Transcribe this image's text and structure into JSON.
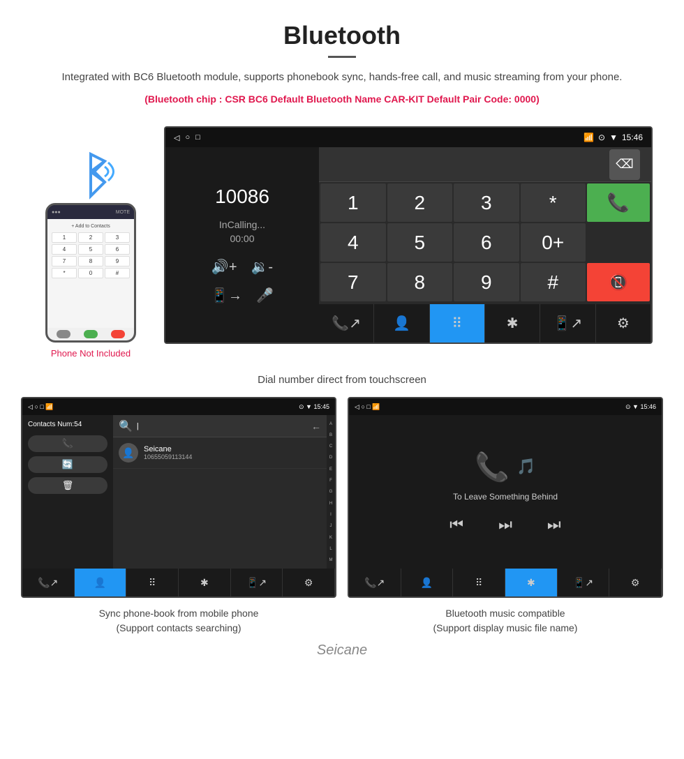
{
  "header": {
    "title": "Bluetooth",
    "description": "Integrated with BC6 Bluetooth module, supports phonebook sync, hands-free call, and music streaming from your phone.",
    "specs": "(Bluetooth chip : CSR BC6    Default Bluetooth Name CAR-KIT    Default Pair Code: 0000)"
  },
  "phone_side": {
    "not_included": "Phone Not Included"
  },
  "status_bar_main": {
    "left": [
      "◁",
      "○",
      "□"
    ],
    "right": "☎  ⊙  ▼  15:46"
  },
  "dial_screen": {
    "number": "10086",
    "status": "InCalling...",
    "time": "00:00",
    "keys": [
      "1",
      "2",
      "3",
      "*",
      "4",
      "5",
      "6",
      "0+",
      "7",
      "8",
      "9",
      "#"
    ]
  },
  "caption_main": "Dial number direct from touchscreen",
  "contacts_screen": {
    "contacts_num": "Contacts Num:54",
    "contact": {
      "name": "Seicane",
      "number": "10655059113144"
    },
    "alphabet": [
      "A",
      "B",
      "C",
      "D",
      "E",
      "F",
      "G",
      "H",
      "I",
      "J",
      "K",
      "L",
      "M"
    ]
  },
  "music_screen": {
    "song_title": "To Leave Something Behind"
  },
  "captions": {
    "left": "Sync phone-book from mobile phone\n(Support contacts searching)",
    "right": "Bluetooth music compatible\n(Support display music file name)"
  },
  "watermark": "Seicane",
  "status_bar_small_left": {
    "right": "☎  ⊙  ▼  15:45"
  },
  "status_bar_small_right": {
    "right": "☎  ⊙  ▼  15:46"
  }
}
